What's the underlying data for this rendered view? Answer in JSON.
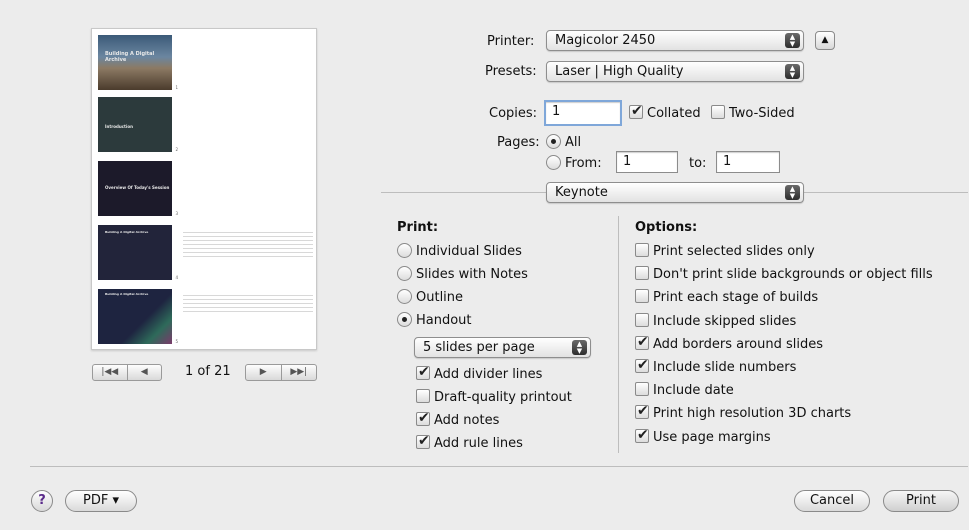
{
  "preview": {
    "slides": [
      {
        "title": "Building A Digital Archive",
        "page": "1"
      },
      {
        "title": "Introduction",
        "page": "2"
      },
      {
        "title": "Overview Of Today's Session",
        "page": "3"
      },
      {
        "title": "Building A Digital Archive",
        "page": "4"
      },
      {
        "title": "Building A Digital Archive",
        "page": "5"
      }
    ],
    "page_indicator": "1 of 21"
  },
  "printer": {
    "label": "Printer:",
    "value": "Magicolor 2450"
  },
  "presets": {
    "label": "Presets:",
    "value": "Laser | High Quality"
  },
  "copies": {
    "label": "Copies:",
    "value": "1",
    "collated": "Collated",
    "two_sided": "Two-Sided"
  },
  "pages": {
    "label": "Pages:",
    "all": "All",
    "from": "From:",
    "from_value": "1",
    "to": "to:",
    "to_value": "1"
  },
  "section_popup": "Keynote",
  "print_section": {
    "heading": "Print:",
    "options": [
      "Individual Slides",
      "Slides with Notes",
      "Outline",
      "Handout"
    ],
    "handout_layout": "5 slides per page",
    "handout_options": [
      {
        "label": "Add divider lines",
        "checked": true
      },
      {
        "label": "Draft-quality printout",
        "checked": false
      },
      {
        "label": "Add notes",
        "checked": true
      },
      {
        "label": "Add rule lines",
        "checked": true
      }
    ]
  },
  "options_section": {
    "heading": "Options:",
    "items": [
      {
        "label": "Print selected slides only",
        "checked": false
      },
      {
        "label": "Don't print slide backgrounds or object fills",
        "checked": false
      },
      {
        "label": "Print each stage of builds",
        "checked": false
      },
      {
        "label": "Include skipped slides",
        "checked": false
      },
      {
        "label": "Add borders around slides",
        "checked": true
      },
      {
        "label": "Include slide numbers",
        "checked": true
      },
      {
        "label": "Include date",
        "checked": false
      },
      {
        "label": "Print high resolution 3D charts",
        "checked": true
      },
      {
        "label": "Use page margins",
        "checked": true
      }
    ]
  },
  "footer": {
    "help": "?",
    "pdf": "PDF ▾",
    "cancel": "Cancel",
    "print": "Print"
  }
}
